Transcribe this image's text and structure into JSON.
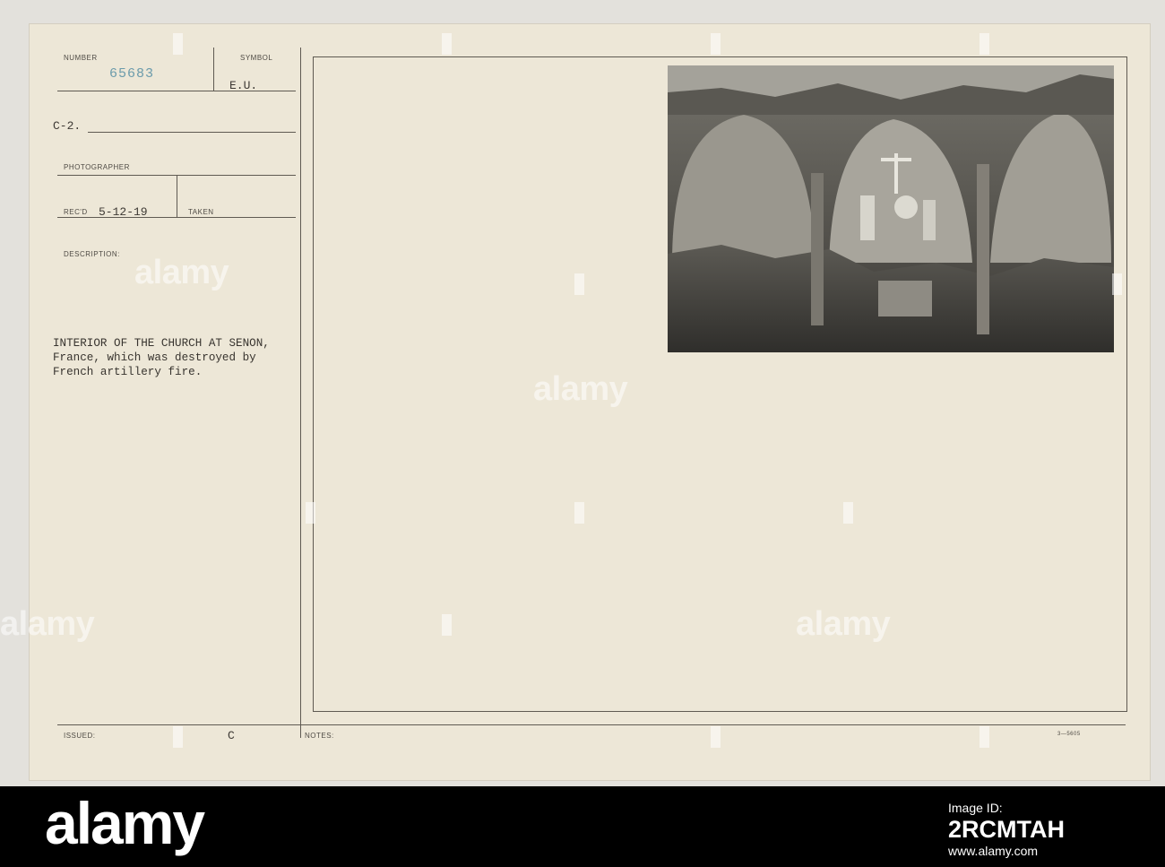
{
  "card": {
    "number_label": "NUMBER",
    "number_value": "65683",
    "symbol_label": "SYMBOL",
    "symbol_value": "E.U.",
    "code": "C-2.",
    "photographer_label": "PHOTOGRAPHER",
    "recd_label": "REC'D",
    "recd_value": "5-12-19",
    "taken_label": "TAKEN",
    "description_label": "DESCRIPTION:",
    "description_lines": [
      "INTERIOR OF THE CHURCH AT SENON,",
      "France, which was destroyed by",
      "French artillery fire."
    ],
    "issued_label": "ISSUED:",
    "issued_value": "C",
    "notes_label": "NOTES:",
    "form_code": "3—5605"
  },
  "watermark": {
    "text": "alamy"
  },
  "footer": {
    "logo": "alamy",
    "image_id_label": "Image ID:",
    "image_id": "2RCMTAH",
    "url": "www.alamy.com"
  }
}
